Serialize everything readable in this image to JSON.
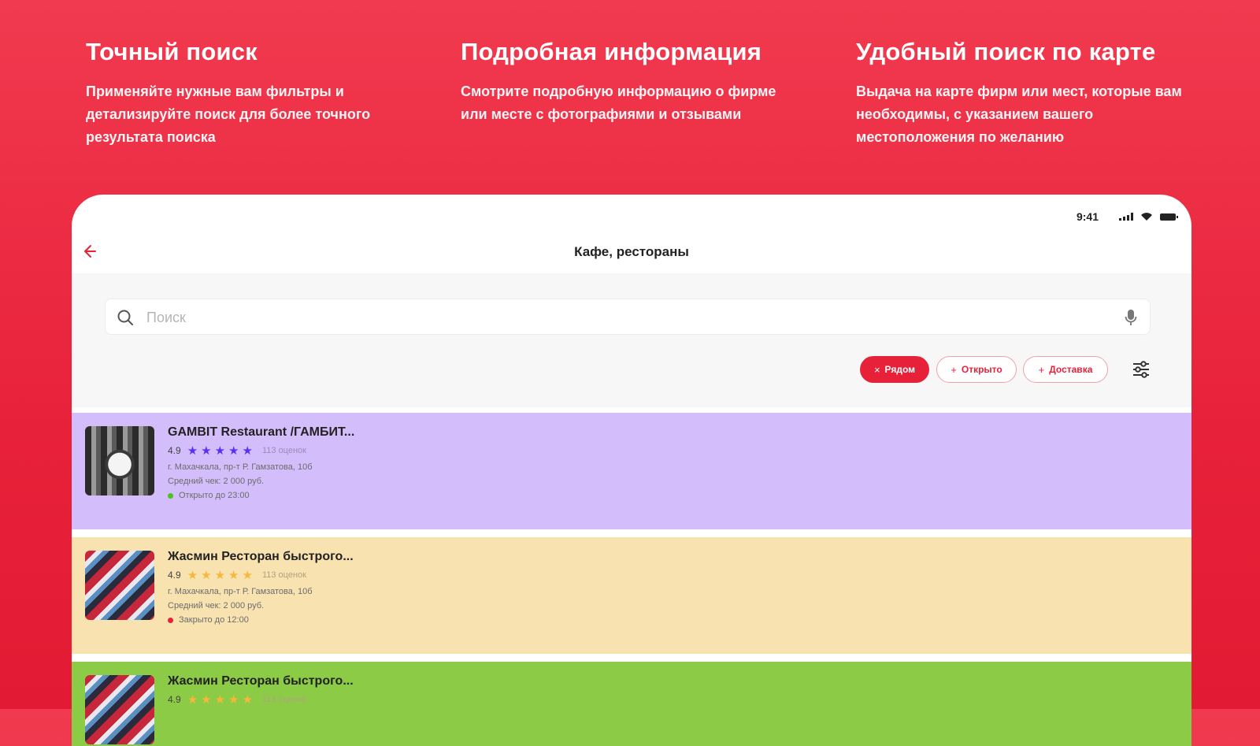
{
  "features": [
    {
      "title": "Точный поиск",
      "text": "Применяйте нужные вам фильтры и детализируйте поиск для более точного результата поиска"
    },
    {
      "title": "Подробная информация",
      "text": "Смотрите подробную информацию о фирме или месте с фотографиями и отзывами"
    },
    {
      "title": "Удобный поиск по карте",
      "text": "Выдача на карте фирм или мест, которые вам необходимы, с указанием вашего местоположения по желанию"
    }
  ],
  "status_bar": {
    "time": "9:41"
  },
  "nav": {
    "title": "Кафе, рестораны"
  },
  "search": {
    "placeholder": "Поиск"
  },
  "chips": [
    {
      "label": "Рядом",
      "mark": "×"
    },
    {
      "label": "Открыто",
      "mark": "+"
    },
    {
      "label": "Доставка",
      "mark": "+"
    }
  ],
  "places": [
    {
      "name": "GAMBIT Restaurant /ГАМБИТ...",
      "score": "4.9",
      "stars": 5,
      "reviews": "113 оценок",
      "address": "г. Махачкала, пр-т Р. Гамзатова, 10б",
      "check": "Средний чек: 2 000 руб.",
      "status": "Открыто до 23:00"
    },
    {
      "name": "Жасмин Ресторан быстрого...",
      "score": "4.9",
      "stars": 5,
      "reviews": "113 оценок",
      "address": "г. Махачкала, пр-т Р. Гамзатова, 10б",
      "check": "Средний чек: 2 000 руб.",
      "status": "Закрыто до 12:00"
    },
    {
      "name": "Жасмин Ресторан быстрого...",
      "score": "4.9",
      "stars": 5,
      "reviews": "113 оценок"
    }
  ],
  "colors": {
    "brand": "#e8213a",
    "card_purple": "#d3bdfb",
    "card_yellow": "#f8e2b0",
    "card_green": "#8ccb46"
  }
}
